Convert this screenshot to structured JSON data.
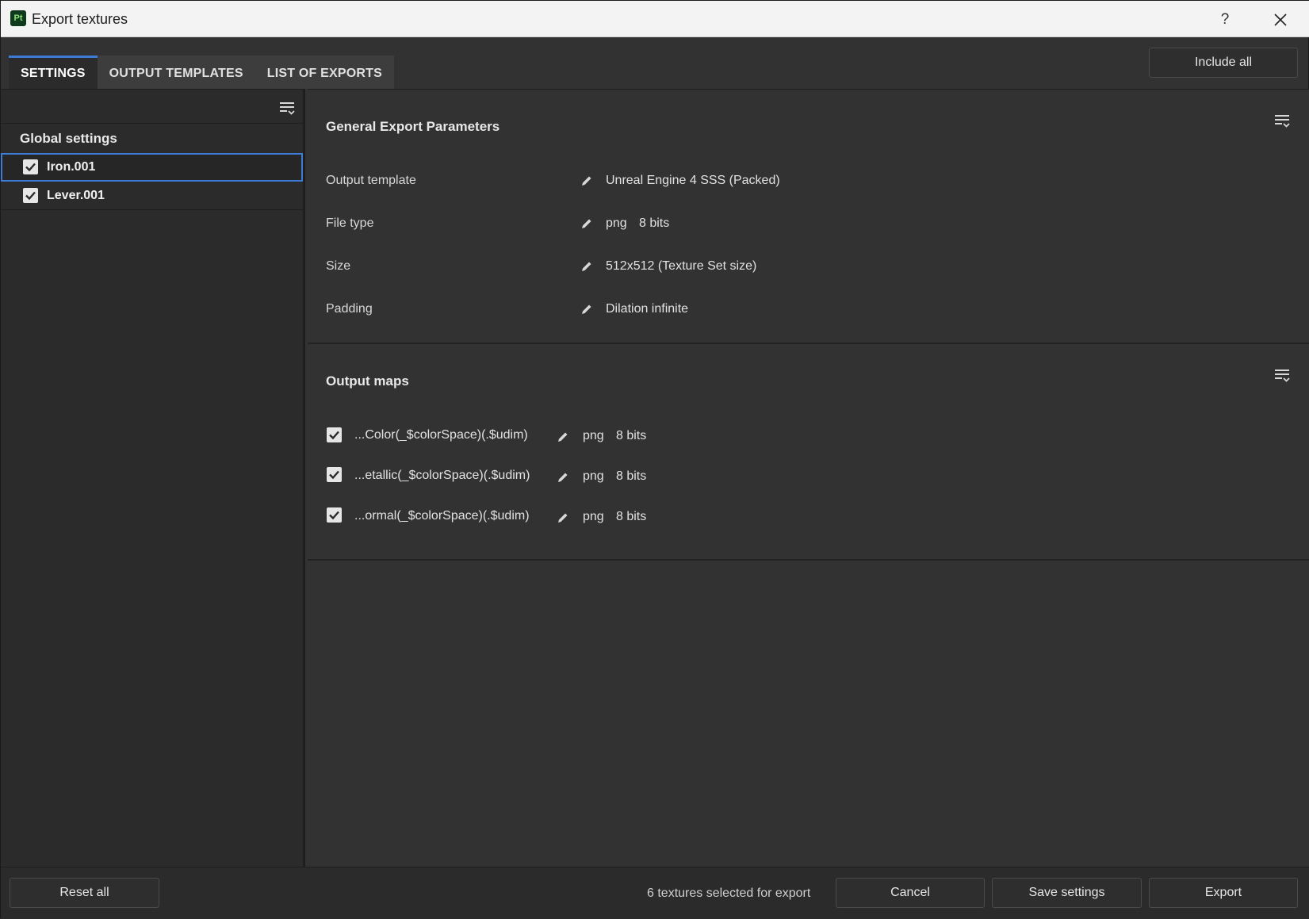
{
  "window": {
    "title": "Export textures",
    "app_icon_text": "Pt",
    "help_label": "?"
  },
  "tabs": [
    {
      "label": "SETTINGS",
      "active": true
    },
    {
      "label": "OUTPUT TEMPLATES",
      "active": false
    },
    {
      "label": "LIST OF EXPORTS",
      "active": false
    }
  ],
  "include_all_label": "Include all",
  "left_panel": {
    "global_settings_label": "Global settings",
    "texture_sets": [
      {
        "label": "Iron.001",
        "checked": true,
        "selected": true
      },
      {
        "label": "Lever.001",
        "checked": true,
        "selected": false
      }
    ]
  },
  "general": {
    "title": "General Export Parameters",
    "params": [
      {
        "label": "Output template",
        "value": "Unreal Engine 4 SSS (Packed)"
      },
      {
        "label": "File type",
        "value": "png",
        "extra": "8 bits"
      },
      {
        "label": "Size",
        "value": "512x512 (Texture Set size)"
      },
      {
        "label": "Padding",
        "value": "Dilation infinite"
      }
    ]
  },
  "output_maps": {
    "title": "Output maps",
    "maps": [
      {
        "name": "...Color(_$colorSpace)(.$udim)",
        "format": "png",
        "bits": "8 bits",
        "checked": true
      },
      {
        "name": "...etallic(_$colorSpace)(.$udim)",
        "format": "png",
        "bits": "8 bits",
        "checked": true
      },
      {
        "name": "...ormal(_$colorSpace)(.$udim)",
        "format": "png",
        "bits": "8 bits",
        "checked": true
      }
    ]
  },
  "footer": {
    "reset_label": "Reset all",
    "status": "6 textures selected for export",
    "cancel_label": "Cancel",
    "save_label": "Save settings",
    "export_label": "Export"
  },
  "icons": {
    "menu": "list-menu-icon",
    "edit": "pencil-icon",
    "check": "checkbox-checked-icon",
    "close": "close-icon"
  },
  "colors": {
    "accent": "#3d7bd6",
    "panel_bg": "#323232",
    "sidebar_bg": "#2b2b2b",
    "titlebar_bg": "#f3f3f3"
  }
}
